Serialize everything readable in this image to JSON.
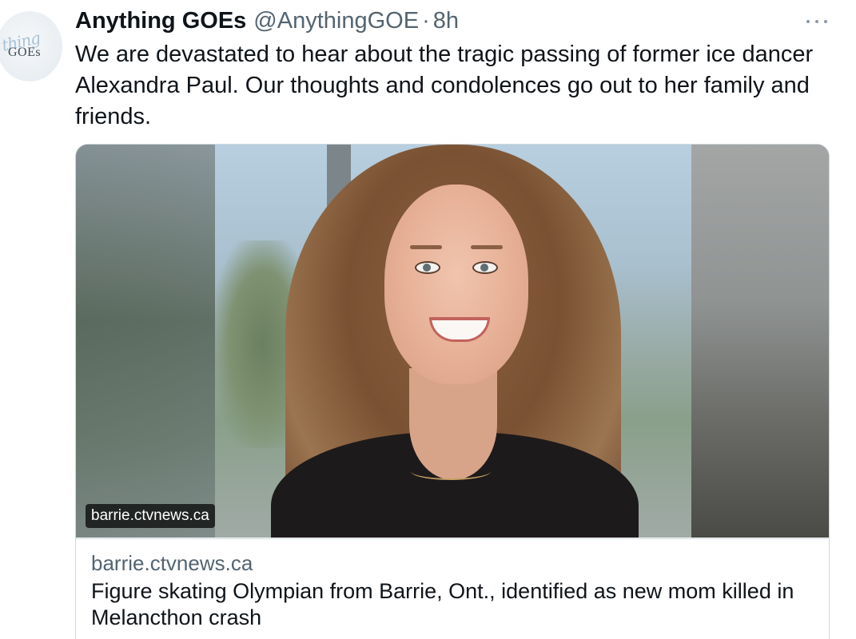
{
  "tweet": {
    "author": {
      "avatar_logo": "GOEs",
      "avatar_script": "thing",
      "name": "Anything GOEs",
      "handle": "@AnythingGOE",
      "separator": "·",
      "time": "8h"
    },
    "more_icon": "more-horizontal-icon",
    "text": "We are devastated to hear about the tragic passing of former ice dancer Alexandra Paul. Our thoughts and condolences go out to her family and friends.",
    "card": {
      "image_badge": "barrie.ctvnews.ca",
      "domain": "barrie.ctvnews.ca",
      "title": "Figure skating Olympian from Barrie, Ont., identified as new mom killed in Melancthon crash"
    }
  }
}
